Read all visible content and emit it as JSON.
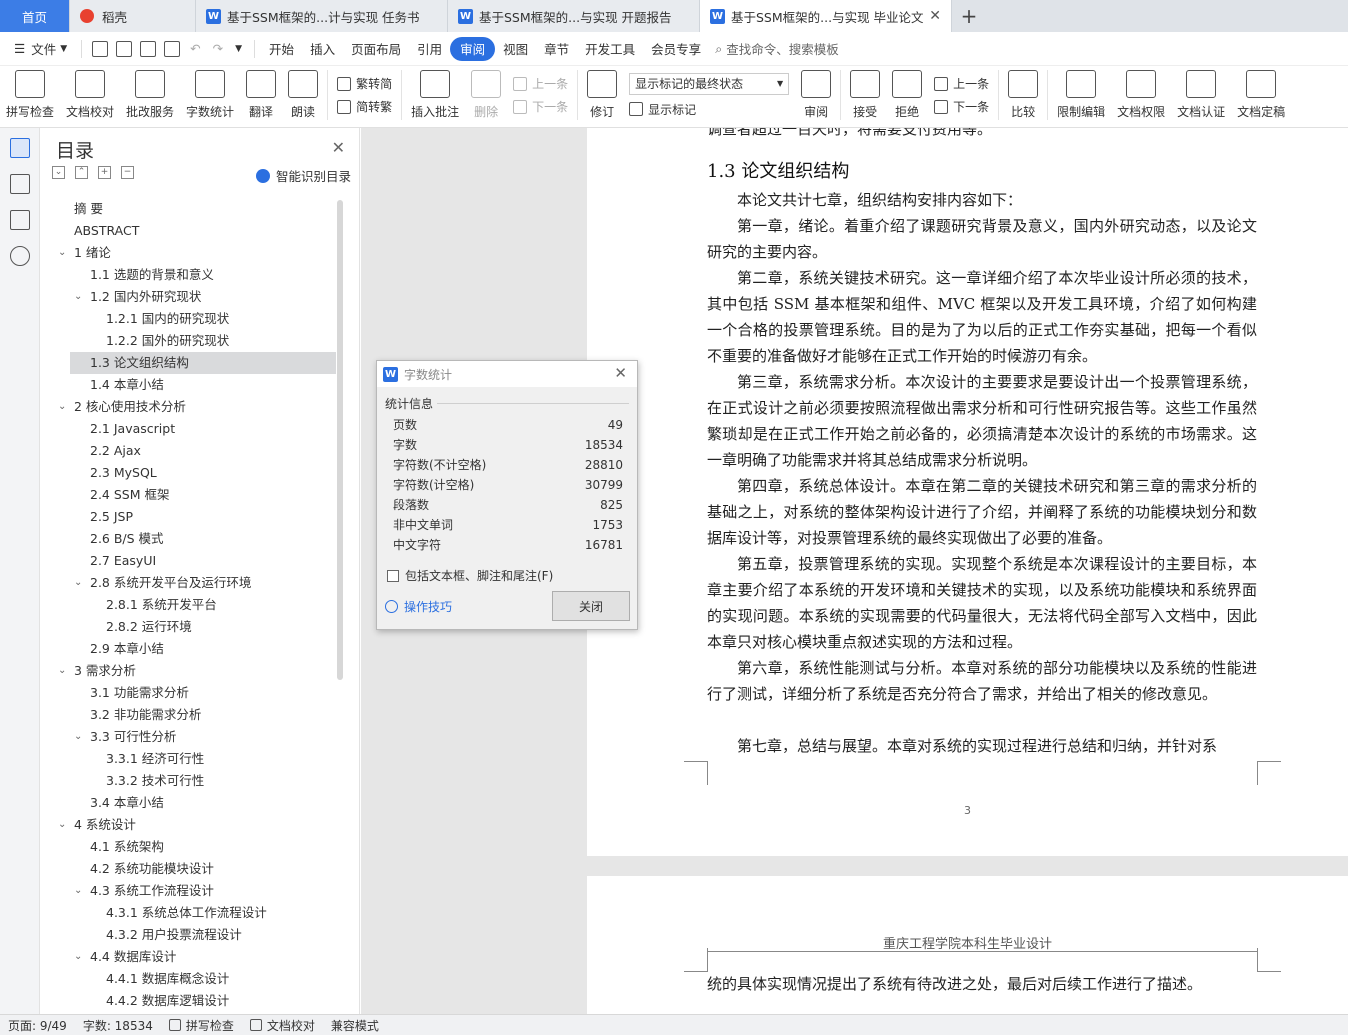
{
  "tabs": [
    {
      "label": "首页"
    },
    {
      "label": "稻壳"
    },
    {
      "label": "基于SSM框架的...计与实现 任务书"
    },
    {
      "label": "基于SSM框架的...与实现 开题报告"
    },
    {
      "label": "基于SSM框架的...与实现 毕业论文"
    }
  ],
  "menubar": {
    "file": "文件",
    "items": [
      "开始",
      "插入",
      "页面布局",
      "引用",
      "审阅",
      "视图",
      "章节",
      "开发工具",
      "会员专享"
    ],
    "search": "查找命令、搜索模板"
  },
  "ribbon": {
    "spell": "拼写检查",
    "doc_check": "文档校对",
    "batch": "批改服务",
    "word_count": "字数统计",
    "translate": "翻译",
    "read": "朗读",
    "trad_to_simp": "繁转简",
    "simp_to_trad": "简转繁",
    "insert_comment": "插入批注",
    "delete": "删除",
    "prev": "上一条",
    "next": "下一条",
    "revise": "修订",
    "display_select": "显示标记的最终状态",
    "show_marks": "显示标记",
    "review": "审阅",
    "accept": "接受",
    "reject": "拒绝",
    "prev2": "上一条",
    "next2": "下一条",
    "compare": "比较",
    "restrict": "限制编辑",
    "rights": "文档权限",
    "certify": "文档认证",
    "finalize": "文档定稿"
  },
  "toc": {
    "title": "目录",
    "smart": "智能识别目录",
    "items": [
      {
        "label": "摘    要",
        "level": 0,
        "selected": false
      },
      {
        "label": "ABSTRACT",
        "level": 0,
        "selected": false
      },
      {
        "label": "1  绪论",
        "level": 0,
        "selected": false,
        "expanded": true
      },
      {
        "label": "1.1  选题的背景和意义",
        "level": 1,
        "selected": false
      },
      {
        "label": "1.2  国内外研究现状",
        "level": 1,
        "selected": false,
        "expanded": true
      },
      {
        "label": "1.2.1  国内的研究现状",
        "level": 2,
        "selected": false
      },
      {
        "label": "1.2.2  国外的研究现状",
        "level": 2,
        "selected": false
      },
      {
        "label": "1.3  论文组织结构",
        "level": 1,
        "selected": true
      },
      {
        "label": "1.4  本章小结",
        "level": 1,
        "selected": false
      },
      {
        "label": "2  核心使用技术分析",
        "level": 0,
        "selected": false,
        "expanded": true
      },
      {
        "label": "2.1 Javascript",
        "level": 1,
        "selected": false
      },
      {
        "label": "2.2 Ajax",
        "level": 1,
        "selected": false
      },
      {
        "label": "2.3 MySQL",
        "level": 1,
        "selected": false
      },
      {
        "label": "2.4 SSM 框架",
        "level": 1,
        "selected": false
      },
      {
        "label": "2.5 JSP",
        "level": 1,
        "selected": false
      },
      {
        "label": "2.6 B/S 模式",
        "level": 1,
        "selected": false
      },
      {
        "label": "2.7 EasyUI",
        "level": 1,
        "selected": false
      },
      {
        "label": "2.8  系统开发平台及运行环境",
        "level": 1,
        "selected": false,
        "expanded": true
      },
      {
        "label": "2.8.1  系统开发平台",
        "level": 2,
        "selected": false
      },
      {
        "label": "2.8.2  运行环境",
        "level": 2,
        "selected": false
      },
      {
        "label": "2.9  本章小结",
        "level": 1,
        "selected": false
      },
      {
        "label": "3  需求分析",
        "level": 0,
        "selected": false,
        "expanded": true
      },
      {
        "label": "3.1  功能需求分析",
        "level": 1,
        "selected": false
      },
      {
        "label": "3.2  非功能需求分析",
        "level": 1,
        "selected": false
      },
      {
        "label": "3.3  可行性分析",
        "level": 1,
        "selected": false,
        "expanded": true
      },
      {
        "label": "3.3.1  经济可行性",
        "level": 2,
        "selected": false
      },
      {
        "label": "3.3.2  技术可行性",
        "level": 2,
        "selected": false
      },
      {
        "label": "3.4  本章小结",
        "level": 1,
        "selected": false
      },
      {
        "label": "4  系统设计",
        "level": 0,
        "selected": false,
        "expanded": true
      },
      {
        "label": "4.1  系统架构",
        "level": 1,
        "selected": false
      },
      {
        "label": "4.2  系统功能模块设计",
        "level": 1,
        "selected": false
      },
      {
        "label": "4.3  系统工作流程设计",
        "level": 1,
        "selected": false,
        "expanded": true
      },
      {
        "label": "4.3.1  系统总体工作流程设计",
        "level": 2,
        "selected": false
      },
      {
        "label": "4.3.2  用户投票流程设计",
        "level": 2,
        "selected": false
      },
      {
        "label": "4.4  数据库设计",
        "level": 1,
        "selected": false,
        "expanded": true
      },
      {
        "label": "4.4.1  数据库概念设计",
        "level": 2,
        "selected": false
      },
      {
        "label": "4.4.2  数据库逻辑设计",
        "level": 2,
        "selected": false
      }
    ]
  },
  "document": {
    "cut_line": "调查者超过一百天时，将需要支付费用等。",
    "heading": "1.3  论文组织结构",
    "paragraphs": [
      "本论文共计七章，组织结构安排内容如下：",
      "第一章，绪论。着重介绍了课题研究背景及意义，国内外研究动态，以及论文研究的主要内容。",
      "第二章，系统关键技术研究。这一章详细介绍了本次毕业设计所必须的技术，其中包括 SSM 基本框架和组件、MVC 框架以及开发工具环境，介绍了如何构建一个合格的投票管理系统。目的是为了为以后的正式工作夯实基础，把每一个看似不重要的准备做好才能够在正式工作开始的时候游刃有余。",
      "第三章，系统需求分析。本次设计的主要要求是要设计出一个投票管理系统，在正式设计之前必须要按照流程做出需求分析和可行性研究报告等。这些工作虽然繁琐却是在正式工作开始之前必备的，必须搞清楚本次设计的系统的市场需求。这一章明确了功能需求并将其总结成需求分析说明。",
      "第四章，系统总体设计。本章在第二章的关键技术研究和第三章的需求分析的基础之上，对系统的整体架构设计进行了介绍，并阐释了系统的功能模块划分和数据库设计等，对投票管理系统的最终实现做出了必要的准备。",
      "第五章，投票管理系统的实现。实现整个系统是本次课程设计的主要目标，本章主要介绍了本系统的开发环境和关键技术的实现，以及系统功能模块和系统界面的实现问题。本系统的实现需要的代码量很大，无法将代码全部写入文档中，因此本章只对核心模块重点叙述实现的方法和过程。",
      "第六章，系统性能测试与分析。本章对系统的部分功能模块以及系统的性能进行了测试，详细分析了系统是否充分符合了需求，并给出了相关的修改意见。",
      "第七章，总结与展望。本章对系统的实现过程进行总结和归纳，并针对系"
    ],
    "page_number": "3",
    "page2_header": "重庆工程学院本科生毕业设计",
    "page2_text": "统的具体实现情况提出了系统有待改进之处，最后对后续工作进行了描述。"
  },
  "dialog": {
    "title": "字数统计",
    "group": "统计信息",
    "stats": [
      {
        "label": "页数",
        "value": "49"
      },
      {
        "label": "字数",
        "value": "18534"
      },
      {
        "label": "字符数(不计空格)",
        "value": "28810"
      },
      {
        "label": "字符数(计空格)",
        "value": "30799"
      },
      {
        "label": "段落数",
        "value": "825"
      },
      {
        "label": "非中文单词",
        "value": "1753"
      },
      {
        "label": "中文字符",
        "value": "16781"
      }
    ],
    "checkbox": "包括文本框、脚注和尾注(F)",
    "tips": "操作技巧",
    "close": "关闭"
  },
  "statusbar": {
    "page": "页面: 9/49",
    "words": "字数: 18534",
    "spell": "拼写检查",
    "doc_check": "文档校对",
    "compat": "兼容模式"
  }
}
